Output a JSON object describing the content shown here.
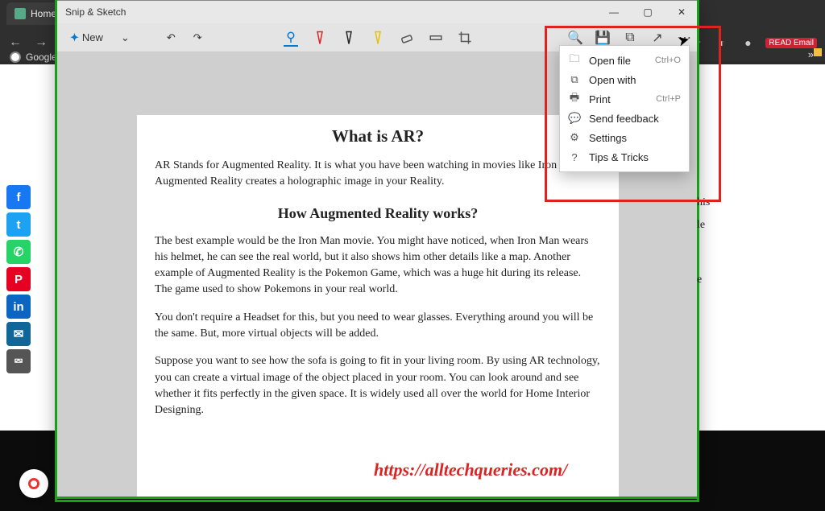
{
  "browser": {
    "tab_title": "Home P",
    "bookmark": "Google",
    "extensions": {
      "read_label": "READ Email"
    }
  },
  "snip": {
    "title": "Snip & Sketch",
    "toolbar": {
      "new_label": "New"
    },
    "menu": {
      "open_file": {
        "label": "Open file",
        "shortcut": "Ctrl+O"
      },
      "open_with": {
        "label": "Open with",
        "shortcut": ""
      },
      "print": {
        "label": "Print",
        "shortcut": "Ctrl+P"
      },
      "feedback": {
        "label": "Send feedback",
        "shortcut": ""
      },
      "settings": {
        "label": "Settings",
        "shortcut": ""
      },
      "tips": {
        "label": "Tips & Tricks",
        "shortcut": ""
      }
    }
  },
  "doc": {
    "h1": "What is AR?",
    "p1": "AR Stands for Augmented Reality. It is what you have been watching in movies like Iron Augmented Reality creates a holographic image in your Reality.",
    "h2": "How Augmented Reality works?",
    "p2": "The best example would be the Iron Man movie. You might have noticed, when Iron Man wears his helmet, he can see the real world, but it also shows him other details like a map. Another example of Augmented Reality is the Pokemon Game, which was a huge hit during its release. The game used to show Pokemons in your real world.",
    "p3": "You don't require a Headset for this, but you need to wear glasses. Everything around you will be the same. But, more virtual objects will be added.",
    "p4": "Suppose you want to see how the sofa is going to fit in your living room. By using AR technology, you can create a virtual image of the object placed in your room. You can look around and see whether it fits perfectly in the given space. It is widely used all over the world for Home Interior Designing."
  },
  "watermark": "https://alltechqueries.com/",
  "behind_fragments": {
    "a": "his",
    "b": "le",
    "c": "e"
  },
  "social": {
    "facebook_glyph": "f",
    "twitter_glyph": "t",
    "whatsapp_glyph": "✆",
    "pinterest_glyph": "P",
    "linkedin_glyph": "in",
    "email_glyph": "✉",
    "share_glyph": "⮹"
  }
}
